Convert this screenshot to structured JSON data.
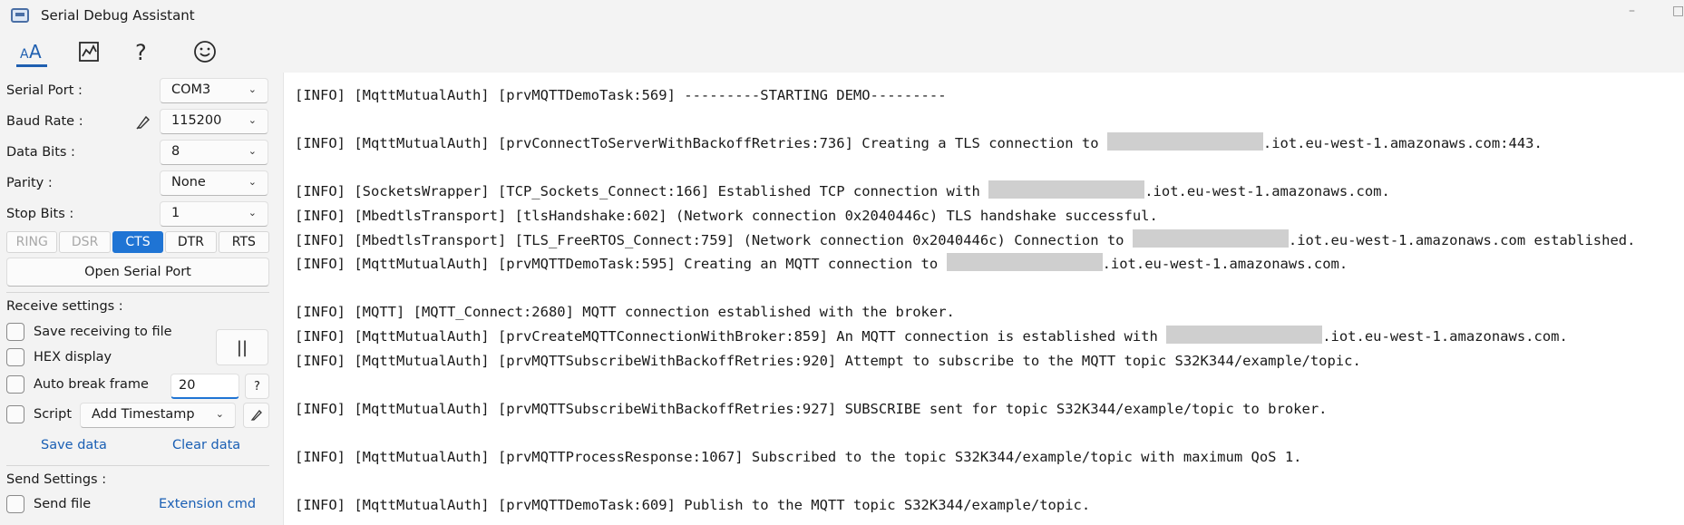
{
  "window": {
    "title": "Serial Debug Assistant"
  },
  "toolbar": {
    "icons": [
      "text-format-icon",
      "chart-icon",
      "help-icon",
      "smiley-icon"
    ]
  },
  "serial": {
    "port_label": "Serial Port :",
    "port_value": "COM3",
    "baud_label": "Baud Rate :",
    "baud_value": "115200",
    "databits_label": "Data Bits :",
    "databits_value": "8",
    "parity_label": "Parity :",
    "parity_value": "None",
    "stopbits_label": "Stop Bits :",
    "stopbits_value": "1",
    "signals": [
      {
        "label": "RING",
        "state": "disabled"
      },
      {
        "label": "DSR",
        "state": "disabled"
      },
      {
        "label": "CTS",
        "state": "on"
      },
      {
        "label": "DTR",
        "state": "off"
      },
      {
        "label": "RTS",
        "state": "off"
      }
    ],
    "open_button": "Open Serial Port"
  },
  "receive": {
    "title": "Receive settings :",
    "save_to_file": "Save receiving to file",
    "hex_display": "HEX display",
    "auto_break": "Auto break frame",
    "auto_break_value": "20",
    "help": "?",
    "script": "Script",
    "script_option": "Add Timestamp",
    "save_data": "Save data",
    "clear_data": "Clear data",
    "pause": "||"
  },
  "send": {
    "title": "Send Settings :",
    "send_file": "Send file",
    "extension_cmd": "Extension cmd"
  },
  "log": [
    {
      "text": "[INFO] [MqttMutualAuth] [prvMQTTDemoTask:569] ---------STARTING DEMO---------"
    },
    {
      "text": ""
    },
    {
      "text": "[INFO] [MqttMutualAuth] [prvConnectToServerWithBackoffRetries:736] Creating a TLS connection to ",
      "redacted": true,
      "tail": ".iot.eu-west-1.amazonaws.com:443."
    },
    {
      "text": ""
    },
    {
      "text": "[INFO] [SocketsWrapper] [TCP_Sockets_Connect:166] Established TCP connection with ",
      "redacted": true,
      "tail": ".iot.eu-west-1.amazonaws.com."
    },
    {
      "text": "[INFO] [MbedtlsTransport] [tlsHandshake:602] (Network connection 0x2040446c) TLS handshake successful."
    },
    {
      "text": "[INFO] [MbedtlsTransport] [TLS_FreeRTOS_Connect:759] (Network connection 0x2040446c) Connection to ",
      "redacted": true,
      "tail": ".iot.eu-west-1.amazonaws.com established."
    },
    {
      "text": "[INFO] [MqttMutualAuth] [prvMQTTDemoTask:595] Creating an MQTT connection to ",
      "redacted": true,
      "tail": ".iot.eu-west-1.amazonaws.com."
    },
    {
      "text": ""
    },
    {
      "text": "[INFO] [MQTT] [MQTT_Connect:2680] MQTT connection established with the broker."
    },
    {
      "text": "[INFO] [MqttMutualAuth] [prvCreateMQTTConnectionWithBroker:859] An MQTT connection is established with ",
      "redacted": true,
      "tail": ".iot.eu-west-1.amazonaws.com."
    },
    {
      "text": "[INFO] [MqttMutualAuth] [prvMQTTSubscribeWithBackoffRetries:920] Attempt to subscribe to the MQTT topic S32K344/example/topic."
    },
    {
      "text": ""
    },
    {
      "text": "[INFO] [MqttMutualAuth] [prvMQTTSubscribeWithBackoffRetries:927] SUBSCRIBE sent for topic S32K344/example/topic to broker."
    },
    {
      "text": ""
    },
    {
      "text": "[INFO] [MqttMutualAuth] [prvMQTTProcessResponse:1067] Subscribed to the topic S32K344/example/topic with maximum QoS 1."
    },
    {
      "text": ""
    },
    {
      "text": "[INFO] [MqttMutualAuth] [prvMQTTDemoTask:609] Publish to the MQTT topic S32K344/example/topic."
    }
  ]
}
